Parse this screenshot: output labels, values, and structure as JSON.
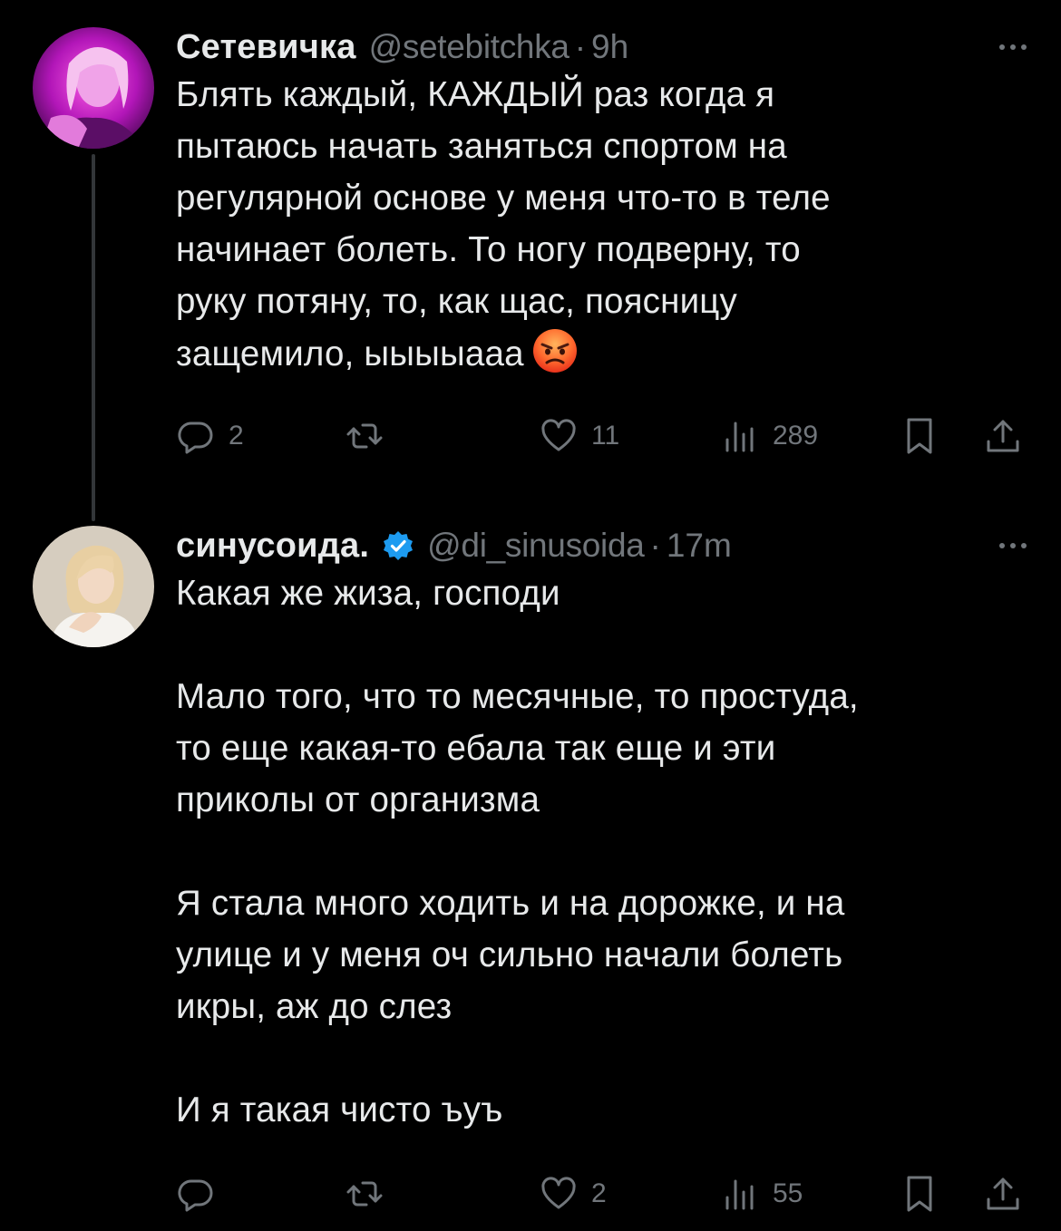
{
  "thread": [
    {
      "author": {
        "display_name": "Сетевичка",
        "handle": "@setebitchka",
        "verified": false
      },
      "separator": "·",
      "time": "9h",
      "paragraphs": [
        [
          "Блять каждый, КАЖДЫЙ раз когда я",
          "пытаюсь начать заняться спортом на",
          "регулярной основе у меня что-то в теле",
          "начинает болеть. То ногу подверну, то",
          "руку потяну, то, как щас, поясницу",
          "защемило, ыыыыааа"
        ]
      ],
      "trailing_emoji": "angry-face-emoji",
      "stats": {
        "replies": "2",
        "retweets": "",
        "likes": "11",
        "views": "289"
      }
    },
    {
      "author": {
        "display_name": "синусоида.",
        "handle": "@di_sinusoida",
        "verified": true
      },
      "separator": "·",
      "time": "17m",
      "paragraphs": [
        [
          "Какая же жиза, господи"
        ],
        [
          "Мало того, что то месячные, то простуда,",
          "то еще какая-то ебала так еще и эти",
          "приколы от организма"
        ],
        [
          "Я стала много ходить и на дорожке, и на",
          "улице и у меня оч сильно начали болеть",
          "икры, аж до слез"
        ],
        [
          "И я такая чисто ъуъ"
        ]
      ],
      "trailing_emoji": "",
      "stats": {
        "replies": "",
        "retweets": "",
        "likes": "2",
        "views": "55"
      }
    }
  ],
  "icons": [
    "reply-icon",
    "retweet-icon",
    "like-icon",
    "views-icon",
    "bookmark-icon",
    "share-icon",
    "more-icon",
    "verified-badge-icon"
  ],
  "colors": {
    "background": "#000000",
    "text": "#e7e9ea",
    "secondary": "#71767b",
    "thread_line": "#333639",
    "verified": "#1d9bf0"
  }
}
